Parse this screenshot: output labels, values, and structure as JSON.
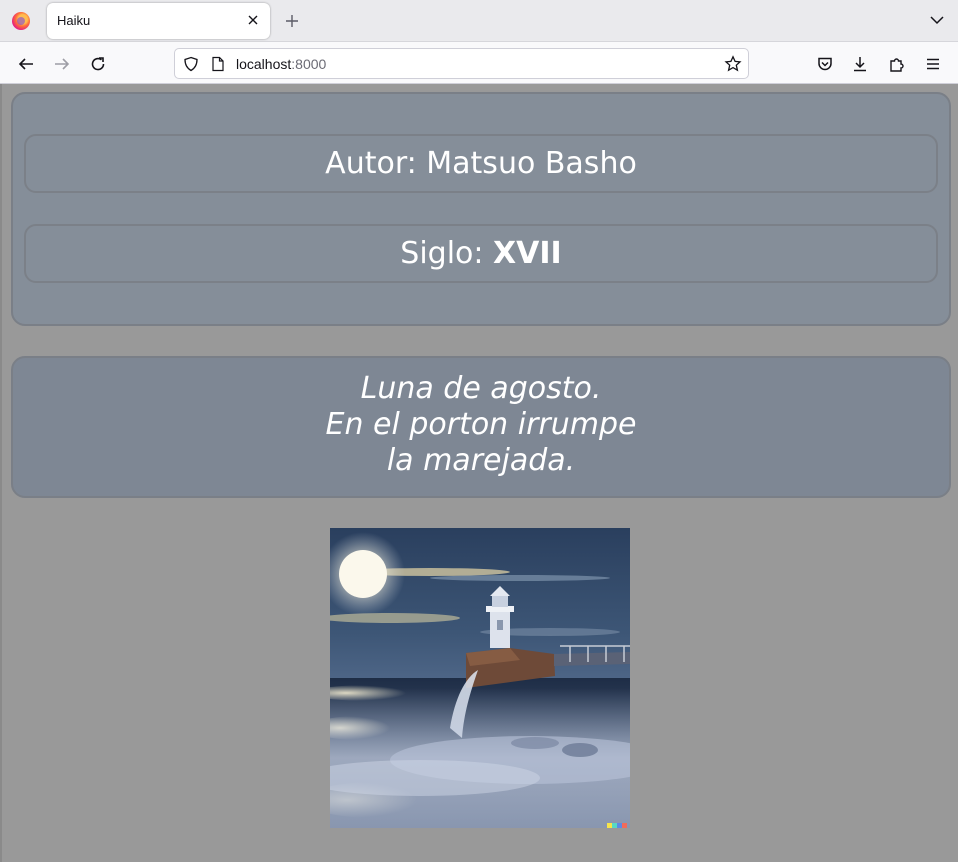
{
  "browser": {
    "tab_title": "Haiku",
    "url_host": "localhost",
    "url_port": ":8000",
    "icons": [
      "firefox-logo-icon",
      "close-icon",
      "plus-icon",
      "chevron-down-icon",
      "back-arrow-icon",
      "forward-arrow-icon",
      "reload-icon",
      "shield-icon",
      "page-icon",
      "star-icon",
      "pocket-icon",
      "download-icon",
      "extensions-icon",
      "menu-icon"
    ]
  },
  "haiku": {
    "author_label": "Autor: ",
    "author": "Matsuo Basho",
    "century_label": "Siglo: ",
    "century": "XVII",
    "lines": [
      "Luna de agosto.",
      "En el porton irrumpe",
      "la marejada."
    ]
  },
  "colors": {
    "page_bg": "#999999",
    "panel_bg": "#858e99",
    "poem_bg": "#7e8794",
    "text": "#ffffff"
  }
}
